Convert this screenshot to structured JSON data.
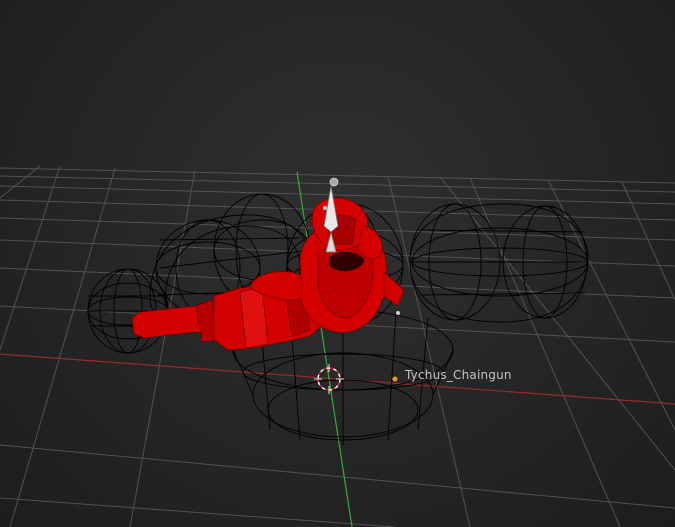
{
  "viewport": {
    "object_label": "Tychus_Chaingun",
    "background_color": "#2a2a2a",
    "grid_color": "#5a5a5a",
    "axis_x_color": "#9a2a2a",
    "axis_y_color": "#3aa83a",
    "wire_color": "#000000",
    "mesh_color": "#d40000",
    "cursor_icon": "3d-cursor-icon",
    "origin_icon": "object-origin-icon",
    "bone_icon": "bone-icon"
  }
}
